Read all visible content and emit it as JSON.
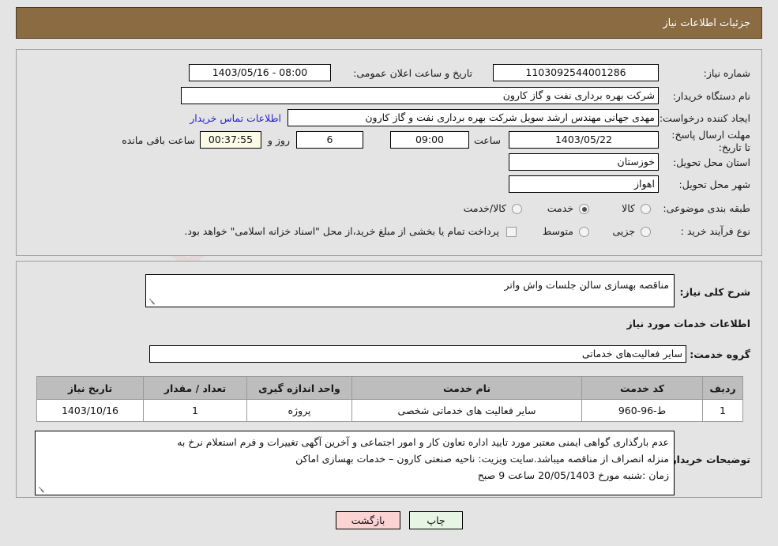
{
  "window": {
    "title": "جزئیات اطلاعات نیاز",
    "header_bg": "#8a6b42"
  },
  "watermark": {
    "text": "AriaTender.net"
  },
  "need_info": {
    "need_number_label": "شماره نیاز:",
    "need_number_value": "1103092544001286",
    "announce_datetime_label": "تاریخ و ساعت اعلان عمومی:",
    "announce_datetime_value": "08:00 - 1403/05/16",
    "buyer_org_label": "نام دستگاه خریدار:",
    "buyer_org_value": "شرکت بهره برداری نفت و گاز کارون",
    "requester_label": "ایجاد کننده درخواست:",
    "requester_value": "مهدی جهانی مهندس ارشد سویل شرکت بهره برداری نفت و گاز کارون",
    "contact_link": "اطلاعات تماس خریدار",
    "deadline_label": "مهلت ارسال پاسخ: تا تاریخ:",
    "deadline_date": "1403/05/22",
    "deadline_time_label": "ساعت",
    "deadline_time": "09:00",
    "days_remaining": "6",
    "days_and_label": "روز و",
    "time_remaining": "00:37:55",
    "time_remaining_label": "ساعت باقی مانده",
    "province_label": "استان محل تحویل:",
    "province_value": "خوزستان",
    "city_label": "شهر محل تحویل:",
    "city_value": "اهواز",
    "category_label": "طبقه بندی موضوعی:",
    "category_options": [
      {
        "label": "کالا",
        "selected": false
      },
      {
        "label": "خدمت",
        "selected": true
      },
      {
        "label": "کالا/خدمت",
        "selected": false
      }
    ],
    "process_label": "نوع فرآیند خرید :",
    "process_options": [
      {
        "label": "جزیی",
        "selected": false
      },
      {
        "label": "متوسط",
        "selected": false
      }
    ],
    "treasury_checkbox_checked": false,
    "treasury_note": "پرداخت تمام یا بخشی از مبلغ خرید،از محل \"اسناد خزانه اسلامی\" خواهد بود."
  },
  "need_description": {
    "label": "شرح کلی نیاز:",
    "value": "مناقصه بهسازی سالن جلسات واش واتر"
  },
  "services_section": {
    "title": "اطلاعات خدمات مورد نیاز",
    "service_group_label": "گروه خدمت:",
    "service_group_value": "سایر فعالیت‌های خدماتی",
    "table": {
      "headers": [
        "ردیف",
        "کد خدمت",
        "نام خدمت",
        "واحد اندازه گیری",
        "تعداد / مقدار",
        "تاریخ نیاز"
      ],
      "rows": [
        {
          "row_no": "1",
          "service_code": "ط-96-960",
          "service_name": "سایر فعالیت های خدماتی شخصی",
          "unit": "پروژه",
          "quantity": "1",
          "need_date": "1403/10/16"
        }
      ]
    }
  },
  "buyer_notes": {
    "label": "توضیحات خریدار:",
    "line1": "عدم بارگذاری گواهی ایمنی معتبر مورد تایید اداره تعاون کار و امور اجتماعی و آخرین آگهی تغییرات و فرم استعلام نرخ به",
    "line2": "منزله انصراف از مناقصه میباشد.سایت ویزیت: ناحیه صنعتی کارون – خدمات بهسازی اماکن",
    "line3": "زمان :شنبه مورخ 20/05/1403 ساعت 9 صبح"
  },
  "footer": {
    "back_label": "بازگشت",
    "print_label": "چاپ"
  }
}
